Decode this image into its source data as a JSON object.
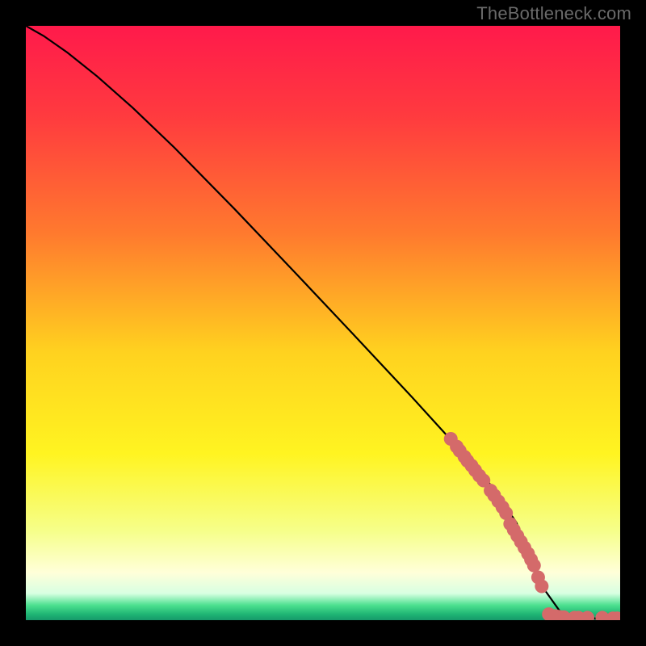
{
  "watermark": "TheBottleneck.com",
  "chart_data": {
    "type": "line",
    "title": "",
    "xlabel": "",
    "ylabel": "",
    "xlim": [
      0,
      100
    ],
    "ylim": [
      0,
      100
    ],
    "grid": false,
    "background_gradient": {
      "stops": [
        {
          "offset": 0.0,
          "color": "#ff1a4b"
        },
        {
          "offset": 0.15,
          "color": "#ff3a3f"
        },
        {
          "offset": 0.35,
          "color": "#ff7a2e"
        },
        {
          "offset": 0.55,
          "color": "#ffd21f"
        },
        {
          "offset": 0.72,
          "color": "#fff421"
        },
        {
          "offset": 0.85,
          "color": "#f6ff8a"
        },
        {
          "offset": 0.92,
          "color": "#ffffd9"
        },
        {
          "offset": 0.955,
          "color": "#d8ffe2"
        },
        {
          "offset": 0.975,
          "color": "#4be08f"
        },
        {
          "offset": 0.99,
          "color": "#1fb574"
        },
        {
          "offset": 1.0,
          "color": "#16996a"
        }
      ]
    },
    "series": [
      {
        "name": "curve",
        "type": "line",
        "color": "#000000",
        "x": [
          0,
          3,
          7,
          12,
          18,
          25,
          35,
          45,
          55,
          65,
          72,
          78,
          82.5,
          85,
          87,
          90,
          93,
          96,
          100
        ],
        "y": [
          100,
          98.3,
          95.5,
          91.5,
          86.2,
          79.5,
          69.3,
          58.8,
          48.2,
          37.5,
          29.8,
          23,
          16.5,
          10.8,
          5.5,
          1.3,
          0.4,
          0.3,
          0.2
        ]
      },
      {
        "name": "points",
        "type": "scatter",
        "color": "#d46a6a",
        "x": [
          71.5,
          72.5,
          73.0,
          73.8,
          74.3,
          75.0,
          75.6,
          76.3,
          77.0,
          78.2,
          78.8,
          79.5,
          80.2,
          80.8,
          81.5,
          82.1,
          82.7,
          83.3,
          83.9,
          84.5,
          85.0,
          85.5,
          86.2,
          86.8,
          88.0,
          88.5,
          89.0,
          89.5,
          90.0,
          90.5,
          92.3,
          93.0,
          94.5,
          97.0,
          98.8,
          99.5
        ],
        "y": [
          30.5,
          29.2,
          28.5,
          27.5,
          26.8,
          26.0,
          25.2,
          24.3,
          23.5,
          21.8,
          21.0,
          20.0,
          19.0,
          18.0,
          16.2,
          15.2,
          14.2,
          13.2,
          12.2,
          11.2,
          10.2,
          9.2,
          7.2,
          5.7,
          1.0,
          0.7,
          0.7,
          0.6,
          0.5,
          0.5,
          0.4,
          0.4,
          0.4,
          0.4,
          0.3,
          0.3
        ]
      }
    ]
  }
}
